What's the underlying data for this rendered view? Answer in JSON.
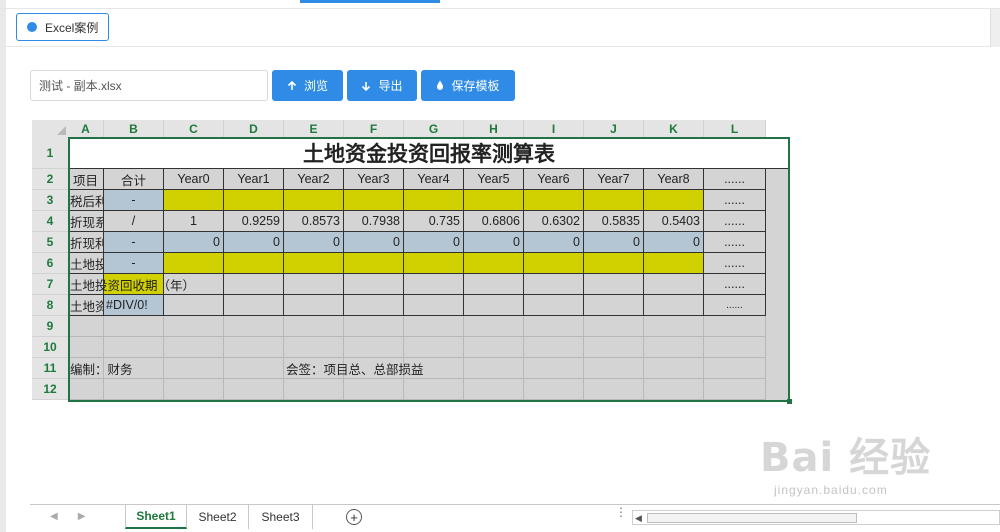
{
  "doc_tab": {
    "label": "Excel案例"
  },
  "toolbar": {
    "file_value": "测试 - 副本.xlsx",
    "browse_label": "浏览",
    "export_label": "导出",
    "save_template_label": "保存模板"
  },
  "sheet": {
    "columns": [
      "A",
      "B",
      "C",
      "D",
      "E",
      "F",
      "G",
      "H",
      "I",
      "J",
      "K",
      "L"
    ],
    "rows": [
      "1",
      "2",
      "3",
      "4",
      "5",
      "6",
      "7",
      "8",
      "9",
      "10",
      "11",
      "12"
    ],
    "title": "土地资金投资回报率测算表",
    "header_row": [
      "项目",
      "合计",
      "Year0",
      "Year1",
      "Year2",
      "Year3",
      "Year4",
      "Year5",
      "Year6",
      "Year7",
      "Year8",
      "......"
    ],
    "row3": {
      "label": "税后利润",
      "total": "-",
      "more": "......"
    },
    "row4": {
      "label": "折现系数",
      "total": "/",
      "values": [
        "1",
        "0.9259",
        "0.8573",
        "0.7938",
        "0.735",
        "0.6806",
        "0.6302",
        "0.5835",
        "0.5403"
      ],
      "more": "......"
    },
    "row5": {
      "label": "折现利润",
      "total": "-",
      "values": [
        "0",
        "0",
        "0",
        "0",
        "0",
        "0",
        "0",
        "0",
        "0"
      ],
      "more": "......"
    },
    "row6": {
      "label": "土地投资额",
      "total": "-",
      "more": "......"
    },
    "row7": {
      "label": "土地投资回收期（年）",
      "more": "......"
    },
    "row8": {
      "label": "土地资金投",
      "total": "#DIV/0!",
      "more": "......"
    },
    "row11": {
      "left": "编制：财务",
      "right": "会签：项目总、总部损益"
    }
  },
  "sheet_tabs": [
    "Sheet1",
    "Sheet2",
    "Sheet3"
  ],
  "watermark": {
    "main": "Bai 经验",
    "sub": "jingyan.baidu.com"
  },
  "colors": {
    "accent": "#2f8be6",
    "yellow": "#d2d100",
    "blue_cell": "#b4c6d4",
    "excel_green": "#217346"
  }
}
